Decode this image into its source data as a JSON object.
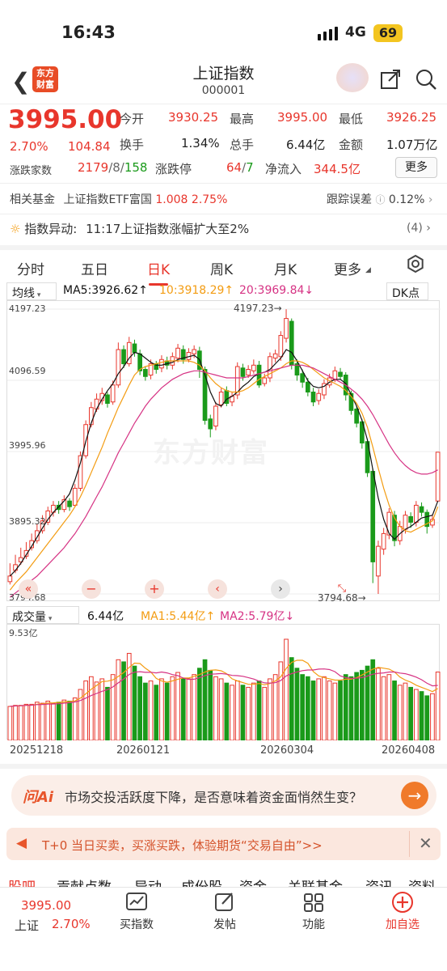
{
  "status": {
    "time": "16:43",
    "network": "4G",
    "battery": "69"
  },
  "header": {
    "title": "上证指数",
    "code": "000001",
    "logo": "东方财富"
  },
  "quote": {
    "price": "3995.00",
    "pct": "2.70%",
    "change": "104.84",
    "open_label": "今开",
    "open": "3930.25",
    "high_label": "最高",
    "high": "3995.00",
    "low_label": "最低",
    "low": "3926.25",
    "turnover_label": "换手",
    "turnover": "1.34%",
    "volume_label": "总手",
    "volume": "6.44亿",
    "amount_label": "金额",
    "amount": "1.07万亿",
    "breadth_label": "涨跌家数",
    "breadth_up": "2179",
    "breadth_mid": "/8/",
    "breadth_down": "158",
    "limit_label": "涨跌停",
    "limit_up": "64",
    "limit_sep": "/",
    "limit_down": "7",
    "inflow_label": "净流入",
    "inflow": "344.5亿",
    "more": "更多"
  },
  "fund": {
    "label": "相关基金",
    "name": "上证指数ETF富国",
    "price": "1.008",
    "pct": "2.75%",
    "err_label": "跟踪误差",
    "err": "0.12%"
  },
  "alert": {
    "label": "指数异动:",
    "text": "11:17上证指数涨幅扩大至2%",
    "count": "(4)"
  },
  "tabs": [
    "分时",
    "五日",
    "日K",
    "周K",
    "月K",
    "更多"
  ],
  "ma": {
    "type": "均线",
    "ma5": "MA5:3926.62↑",
    "ma10": "10:3918.29↑",
    "ma20": "20:3969.84↓",
    "dk": "DK点"
  },
  "axis": {
    "y1": "4197.23",
    "y2": "4096.59",
    "y3": "3995.96",
    "y4": "3895.32",
    "y5": "3794.68",
    "max_mark": "4197.23→",
    "min_mark": "3794.68→"
  },
  "vol": {
    "type": "成交量",
    "v": "6.44亿",
    "ma1": "MA1:5.44亿↑",
    "ma2": "MA2:5.79亿↓",
    "ymax": "9.53亿"
  },
  "dates": [
    "20251218",
    "20260121",
    "20260304",
    "20260408"
  ],
  "watermark": "东方财富",
  "ai": {
    "brand": "问Ai",
    "text": "市场交投活跃度下降，是否意味着资金面悄然生变？"
  },
  "banner": {
    "text": "T+0 当日买卖，买涨买跌，体验期货“交易自由”>>"
  },
  "bottom_tabs": [
    "股吧",
    "贡献点数",
    "异动",
    "成份股",
    "资金",
    "关联基金",
    "资讯",
    "资料"
  ],
  "footer": {
    "name": "上证",
    "price": "3995.00",
    "pct": "2.70%",
    "items": [
      "买指数",
      "发帖",
      "功能",
      "加自选"
    ]
  },
  "colors": {
    "up": "#e8362c",
    "down": "#1a9a1a",
    "ma5": "#111111",
    "ma10": "#f39c12",
    "ma20": "#d63384"
  },
  "chart_data": {
    "type": "candlestick",
    "ylim": [
      3794.68,
      4197.23
    ],
    "candles": [
      [
        3820,
        3812,
        3838,
        3808
      ],
      [
        3836,
        3828,
        3850,
        3824
      ],
      [
        3846,
        3840,
        3860,
        3836
      ],
      [
        3856,
        3848,
        3868,
        3844
      ],
      [
        3870,
        3860,
        3880,
        3856
      ],
      [
        3884,
        3870,
        3894,
        3866
      ],
      [
        3898,
        3884,
        3906,
        3880
      ],
      [
        3912,
        3896,
        3918,
        3892
      ],
      [
        3920,
        3910,
        3926,
        3904
      ],
      [
        3914,
        3920,
        3926,
        3908
      ],
      [
        3928,
        3914,
        3934,
        3910
      ],
      [
        3918,
        3926,
        3930,
        3912
      ],
      [
        3944,
        3920,
        3950,
        3918
      ],
      [
        3990,
        3944,
        3996,
        3940
      ],
      [
        4034,
        3990,
        4040,
        3986
      ],
      [
        4058,
        4034,
        4066,
        4030
      ],
      [
        4070,
        4056,
        4078,
        4052
      ],
      [
        4078,
        4068,
        4086,
        4062
      ],
      [
        4064,
        4076,
        4080,
        4058
      ],
      [
        4090,
        4066,
        4096,
        4062
      ],
      [
        4140,
        4090,
        4150,
        4086
      ],
      [
        4120,
        4140,
        4146,
        4114
      ],
      [
        4150,
        4120,
        4158,
        4116
      ],
      [
        4136,
        4148,
        4154,
        4130
      ],
      [
        4110,
        4134,
        4140,
        4104
      ],
      [
        4102,
        4112,
        4116,
        4096
      ],
      [
        4120,
        4104,
        4126,
        4098
      ],
      [
        4112,
        4120,
        4124,
        4106
      ],
      [
        4126,
        4114,
        4132,
        4108
      ],
      [
        4118,
        4124,
        4130,
        4112
      ],
      [
        4130,
        4118,
        4136,
        4112
      ],
      [
        4142,
        4128,
        4148,
        4122
      ],
      [
        4126,
        4140,
        4146,
        4120
      ],
      [
        4136,
        4126,
        4142,
        4122
      ],
      [
        4140,
        4134,
        4146,
        4128
      ],
      [
        4112,
        4138,
        4144,
        4100
      ],
      [
        4040,
        4112,
        4116,
        4034
      ],
      [
        4028,
        4042,
        4048,
        4016
      ],
      [
        4060,
        4032,
        4066,
        4026
      ],
      [
        4080,
        4062,
        4086,
        4058
      ],
      [
        4064,
        4082,
        4088,
        4060
      ],
      [
        4074,
        4066,
        4080,
        4060
      ],
      [
        4116,
        4076,
        4122,
        4070
      ],
      [
        4102,
        4114,
        4120,
        4096
      ],
      [
        4112,
        4104,
        4118,
        4100
      ],
      [
        4118,
        4110,
        4126,
        4106
      ],
      [
        4090,
        4118,
        4124,
        4086
      ],
      [
        4100,
        4092,
        4106,
        4088
      ],
      [
        4130,
        4100,
        4136,
        4094
      ],
      [
        4134,
        4128,
        4140,
        4122
      ],
      [
        4160,
        4130,
        4166,
        4124
      ],
      [
        4184,
        4156,
        4197,
        4150
      ],
      [
        4118,
        4180,
        4184,
        4112
      ],
      [
        4104,
        4120,
        4126,
        4096
      ],
      [
        4094,
        4106,
        4112,
        4086
      ],
      [
        4080,
        4094,
        4100,
        4074
      ],
      [
        4066,
        4080,
        4086,
        4060
      ],
      [
        4078,
        4068,
        4084,
        4062
      ],
      [
        4092,
        4076,
        4098,
        4070
      ],
      [
        4100,
        4090,
        4106,
        4086
      ],
      [
        4110,
        4098,
        4116,
        4094
      ],
      [
        4102,
        4108,
        4114,
        4098
      ],
      [
        4076,
        4104,
        4108,
        4068
      ],
      [
        4054,
        4078,
        4082,
        4048
      ],
      [
        4036,
        4056,
        4060,
        4030
      ],
      [
        4008,
        4038,
        4042,
        4000
      ],
      [
        3966,
        4010,
        4014,
        3960
      ],
      [
        3840,
        3968,
        3972,
        3810
      ],
      [
        3862,
        3820,
        3870,
        3794.68
      ],
      [
        3880,
        3858,
        3888,
        3850
      ],
      [
        3910,
        3878,
        3916,
        3872
      ],
      [
        3870,
        3906,
        3912,
        3862
      ],
      [
        3890,
        3870,
        3898,
        3864
      ],
      [
        3906,
        3886,
        3912,
        3880
      ],
      [
        3896,
        3904,
        3910,
        3888
      ],
      [
        3920,
        3896,
        3926,
        3890
      ],
      [
        3910,
        3918,
        3924,
        3904
      ],
      [
        3890,
        3910,
        3914,
        3880
      ],
      [
        3900,
        3892,
        3906,
        3888
      ],
      [
        3995,
        3926,
        3995,
        3926
      ]
    ],
    "ma5": [
      3820,
      3828,
      3838,
      3850,
      3862,
      3875,
      3888,
      3900,
      3910,
      3918,
      3926,
      3936,
      3956,
      3980,
      4010,
      4036,
      4056,
      4070,
      4082,
      4092,
      4106,
      4116,
      4128,
      4136,
      4134,
      4128,
      4122,
      4118,
      4118,
      4120,
      4122,
      4126,
      4128,
      4130,
      4132,
      4126,
      4104,
      4080,
      4064,
      4060,
      4070,
      4074,
      4080,
      4088,
      4094,
      4102,
      4106,
      4108,
      4112,
      4120,
      4128,
      4140,
      4136,
      4124,
      4110,
      4096,
      4088,
      4086,
      4088,
      4094,
      4098,
      4098,
      4092,
      4076,
      4060,
      4040,
      4012,
      3970,
      3930,
      3900,
      3880,
      3872,
      3880,
      3886,
      3890,
      3896,
      3902,
      3904,
      3906,
      3926
    ],
    "ma10": [
      3800,
      3810,
      3818,
      3826,
      3836,
      3846,
      3856,
      3866,
      3876,
      3886,
      3896,
      3906,
      3918,
      3932,
      3948,
      3966,
      3984,
      4002,
      4022,
      4040,
      4058,
      4074,
      4090,
      4104,
      4112,
      4116,
      4118,
      4120,
      4122,
      4124,
      4124,
      4124,
      4124,
      4124,
      4122,
      4118,
      4110,
      4100,
      4092,
      4086,
      4082,
      4080,
      4080,
      4082,
      4086,
      4092,
      4098,
      4102,
      4106,
      4110,
      4114,
      4120,
      4124,
      4124,
      4122,
      4118,
      4112,
      4106,
      4100,
      4096,
      4092,
      4088,
      4082,
      4074,
      4064,
      4050,
      4030,
      4002,
      3972,
      3944,
      3920,
      3902,
      3890,
      3884,
      3882,
      3886,
      3890,
      3894,
      3898,
      3918
    ],
    "ma20": [
      3790,
      3796,
      3802,
      3808,
      3814,
      3820,
      3828,
      3836,
      3844,
      3852,
      3860,
      3870,
      3880,
      3892,
      3904,
      3918,
      3932,
      3946,
      3962,
      3978,
      3994,
      4008,
      4022,
      4036,
      4048,
      4060,
      4070,
      4078,
      4086,
      4092,
      4098,
      4102,
      4106,
      4108,
      4110,
      4110,
      4108,
      4106,
      4104,
      4102,
      4100,
      4100,
      4100,
      4100,
      4102,
      4104,
      4106,
      4108,
      4110,
      4112,
      4114,
      4116,
      4118,
      4118,
      4118,
      4116,
      4114,
      4110,
      4106,
      4102,
      4098,
      4094,
      4090,
      4084,
      4078,
      4070,
      4060,
      4048,
      4034,
      4020,
      4006,
      3994,
      3984,
      3976,
      3970,
      3966,
      3964,
      3964,
      3966,
      3970
    ],
    "volume": [
      3.2,
      3.3,
      3.3,
      3.4,
      3.4,
      3.6,
      3.5,
      3.7,
      3.5,
      3.6,
      3.8,
      3.7,
      4.0,
      4.8,
      5.6,
      6.0,
      5.5,
      5.8,
      5.0,
      6.2,
      7.6,
      7.4,
      8.2,
      7.0,
      6.0,
      5.4,
      5.6,
      5.2,
      5.8,
      5.4,
      6.0,
      6.4,
      5.8,
      5.8,
      6.2,
      6.8,
      7.6,
      6.6,
      6.0,
      5.8,
      5.4,
      5.2,
      5.6,
      5.2,
      5.0,
      5.4,
      5.6,
      5.0,
      5.8,
      6.2,
      7.4,
      9.53,
      7.8,
      6.8,
      6.2,
      6.0,
      5.6,
      5.8,
      6.0,
      5.6,
      5.4,
      5.6,
      6.2,
      6.0,
      6.4,
      6.6,
      7.0,
      7.6,
      6.8,
      6.0,
      6.2,
      5.6,
      5.2,
      5.4,
      5.0,
      4.8,
      4.6,
      4.2,
      4.4,
      6.44
    ]
  }
}
